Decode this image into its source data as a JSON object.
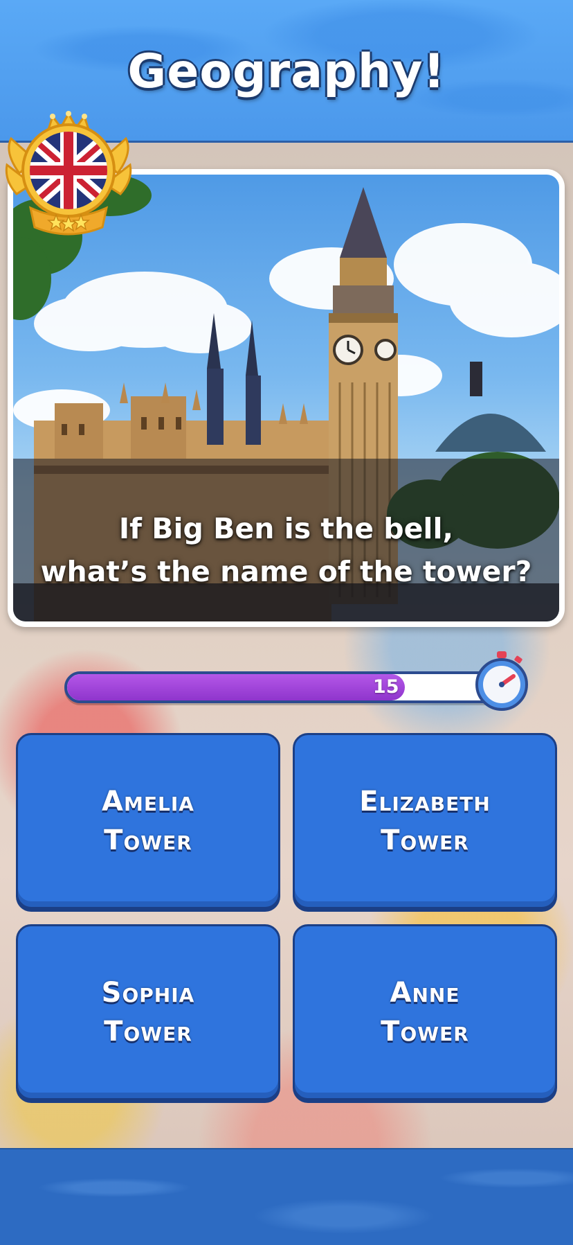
{
  "header": {
    "title": "Geography!"
  },
  "badge": {
    "flag": "union-jack",
    "icon": "crown-wings-icon",
    "stars": 3
  },
  "question": {
    "line1": "If Big Ben is the bell,",
    "line2": "what’s the name of the tower?"
  },
  "timer": {
    "value": "15",
    "fraction": 0.76,
    "icon": "stopwatch-icon"
  },
  "answers": [
    {
      "line1": "Amelia",
      "line2": "Tower"
    },
    {
      "line1": "Elizabeth",
      "line2": "Tower"
    },
    {
      "line1": "Sophia",
      "line2": "Tower"
    },
    {
      "line1": "Anne",
      "line2": "Tower"
    }
  ],
  "colors": {
    "header_blue": "#4b98eb",
    "answer_blue": "#2f74dd",
    "timer_purple": "#9b3fd6",
    "footer_blue": "#2d6bc2"
  }
}
